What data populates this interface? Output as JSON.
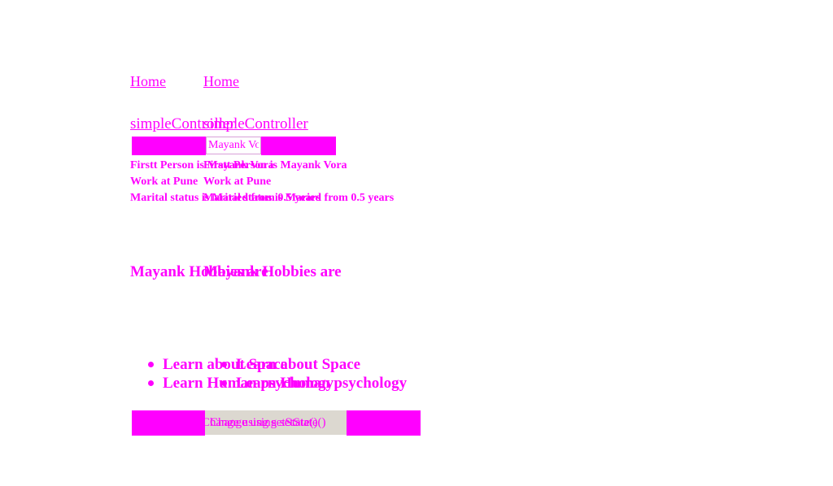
{
  "nav": {
    "home_label": "Home"
  },
  "controller": {
    "link_label": "simpleController"
  },
  "form": {
    "name_value": "Mayank Vora"
  },
  "person": {
    "first_line": "Firstt Person is Mayank Vora",
    "work_line": "Work at Pune",
    "marital_line": "Marital status is Maried from 0.5 years"
  },
  "hobbies": {
    "heading": "Mayank Hobbies are",
    "items": [
      "Learn about Space",
      "Learn Human psychology"
    ]
  },
  "actions": {
    "change_button_label": "Change using setState()"
  },
  "colors": {
    "accent": "#ff00ff",
    "button_bg": "#dcd8d0"
  }
}
